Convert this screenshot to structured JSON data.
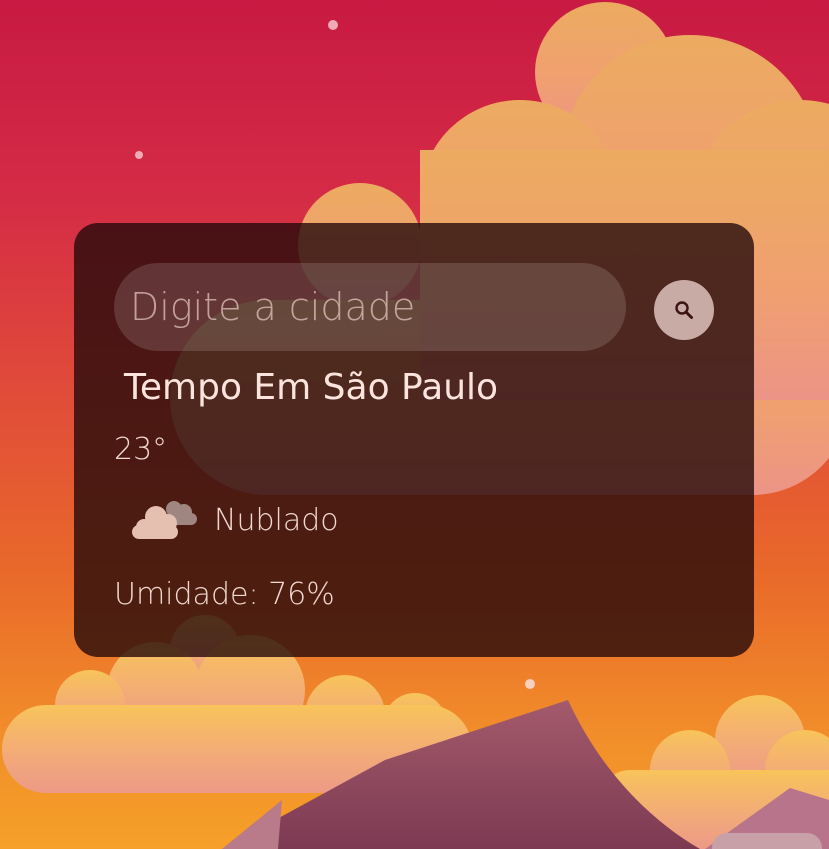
{
  "search": {
    "placeholder": "Digite a cidade",
    "value": "",
    "button_icon": "search-icon"
  },
  "weather": {
    "title": "Tempo Em São Paulo",
    "temperature": "23°",
    "condition_icon": "cloudy-icon",
    "condition": "Nublado",
    "humidity_label": "Umidade: ",
    "humidity_value": "76%"
  },
  "background": {
    "theme": "sunset-sky-with-clouds-and-mountains",
    "sky_colors": [
      "#c81a42",
      "#e04a3a",
      "#f5a028"
    ],
    "cloud_color": "#f2a878",
    "mountain_color": "#9e4a64"
  },
  "colors": {
    "card_background": "#260a0a",
    "text": "#f1d8d0",
    "search_button": "#c9aba5"
  }
}
